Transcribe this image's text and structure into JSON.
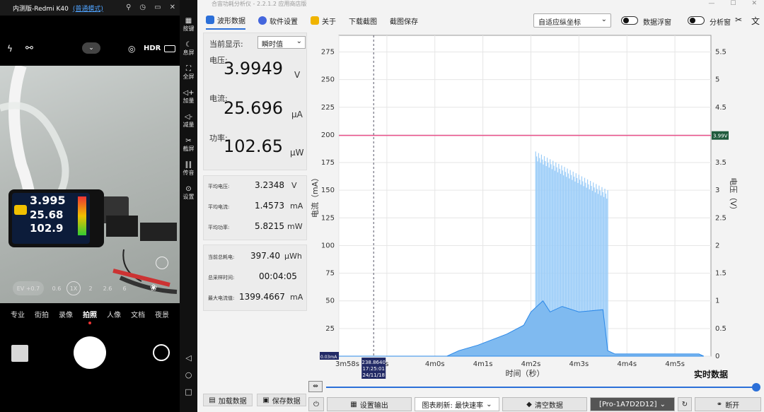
{
  "phone": {
    "title": "内测版-Redmi K40",
    "mode_link": "(普通模式)",
    "hdr_label": "HDR",
    "meter_readings": [
      "3.995",
      "25.68",
      "102.9"
    ],
    "zoom_levels": [
      "0.6",
      "1X",
      "2",
      "2.6",
      "6"
    ],
    "ev_label": "EV +0.7",
    "camera_modes": [
      "专业",
      "街拍",
      "录像",
      "拍照",
      "人像",
      "文档",
      "夜景"
    ],
    "active_mode": "拍照"
  },
  "sidebar": {
    "items": [
      {
        "icon": "keyboard-icon",
        "label": "按键"
      },
      {
        "icon": "moon-icon",
        "label": "息屏"
      },
      {
        "icon": "fullscreen-icon",
        "label": "全屏"
      },
      {
        "icon": "volume-up-icon",
        "label": "加量"
      },
      {
        "icon": "volume-down-icon",
        "label": "减量"
      },
      {
        "icon": "scissors-icon",
        "label": "截屏"
      },
      {
        "icon": "audio-icon",
        "label": "传音"
      },
      {
        "icon": "gear-icon",
        "label": "设置"
      }
    ],
    "nav": [
      "◁",
      "○",
      "□"
    ]
  },
  "app": {
    "window_title": "合宙功耗分析仪 - 2.2.1.2 应用商店版",
    "tabs": [
      {
        "label": "波形数据",
        "color": "#2b6fd8",
        "active": true
      },
      {
        "label": "软件设置",
        "color": "#4466dd",
        "active": false
      },
      {
        "label": "关于",
        "color": "#f0b400",
        "active": false
      },
      {
        "label": "下载截图",
        "color": "",
        "active": false
      },
      {
        "label": "截图保存",
        "color": "",
        "active": false
      }
    ],
    "axis_mode": "自适应纵坐标",
    "toggle_float": "数据浮窗",
    "toggle_analysis": "分析窗"
  },
  "readout": {
    "current_display_label": "当前显示:",
    "display_mode": "瞬时值",
    "voltage_label": "电压:",
    "voltage_value": "3.9949",
    "voltage_unit": "V",
    "current_label": "电流:",
    "current_value": "25.696",
    "current_unit": "μA",
    "power_label": "功率:",
    "power_value": "102.65",
    "power_unit": "μW"
  },
  "stats": {
    "avg_voltage_label": "平均电压:",
    "avg_voltage": "3.2348",
    "avg_voltage_unit": "V",
    "avg_current_label": "平均电流:",
    "avg_current": "1.4573",
    "avg_current_unit": "mA",
    "avg_power_label": "平均功率:",
    "avg_power": "5.8215",
    "avg_power_unit": "mW",
    "total_energy_label": "当前总耗电:",
    "total_energy": "397.40",
    "total_energy_unit": "μWh",
    "sample_time_label": "总采样时间:",
    "sample_time": "00:04:05",
    "max_current_label": "最大电流值:",
    "max_current": "1399.4667",
    "max_current_unit": "mA"
  },
  "left_buttons": {
    "load": "加载数据",
    "save": "保存数据"
  },
  "bottom": {
    "settings": "设置输出",
    "refresh": "图表刷新: 最快速率",
    "clear": "清空数据",
    "device": "[Pro-1A7D2D12]",
    "disconnect": "断开"
  },
  "chart_data": {
    "type": "area",
    "xlabel": "时间（秒）",
    "ylabel_left": "电流（mA）",
    "ylabel_right": "电压（V）",
    "x_ticks": [
      "3m58s",
      "s",
      "4m0s",
      "4m1s",
      "4m2s",
      "4m3s",
      "4m4s",
      "4m5s"
    ],
    "y_left_ticks": [
      0,
      25,
      50,
      75,
      100,
      125,
      150,
      175,
      200,
      225,
      250,
      275
    ],
    "y_left_range": [
      0,
      290
    ],
    "y_right_ticks": [
      0,
      0.5,
      1,
      1.5,
      2,
      2.5,
      3,
      3.5,
      4,
      4.5,
      5,
      5.5
    ],
    "y_right_range": [
      0,
      5.8
    ],
    "voltage_line": 3.99,
    "voltage_badge": "3.99V",
    "min_badge": "0.03mA",
    "cursor_label": [
      "238.8640",
      "17:25:01",
      "24/11/18"
    ],
    "realtime_label": "实时数据",
    "current_series": [
      {
        "t": 0.0,
        "v": 0.03
      },
      {
        "t": 0.45,
        "v": 0.03
      },
      {
        "t": 0.5,
        "v": 5
      },
      {
        "t": 0.58,
        "v": 10
      },
      {
        "t": 0.7,
        "v": 20
      },
      {
        "t": 0.77,
        "v": 28
      },
      {
        "t": 0.8,
        "v": 40
      },
      {
        "t": 0.85,
        "v": 50
      },
      {
        "t": 0.88,
        "v": 40
      },
      {
        "t": 0.93,
        "v": 45
      },
      {
        "t": 1.0,
        "v": 40
      },
      {
        "t": 1.1,
        "v": 42
      },
      {
        "t": 1.12,
        "v": 5
      },
      {
        "t": 1.15,
        "v": 2
      },
      {
        "t": 1.5,
        "v": 2
      },
      {
        "t": 1.52,
        "v": 0.03
      }
    ],
    "spikes": {
      "start": 0.82,
      "end": 1.12,
      "max": 185,
      "min_top": 150
    }
  }
}
